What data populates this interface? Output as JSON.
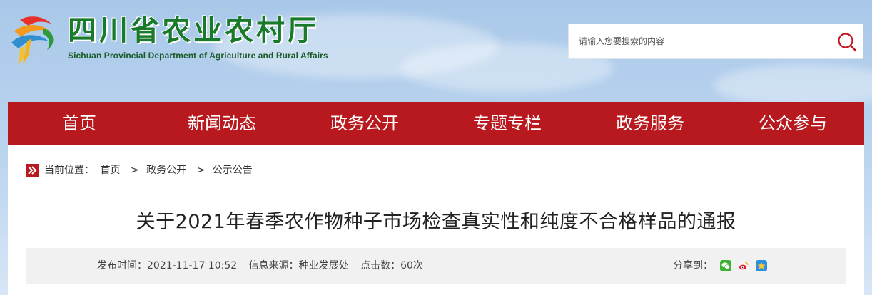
{
  "header": {
    "logo_cn": "四川省农业农村厅",
    "logo_en": "Sichuan Provincial Department of Agriculture and Rural Affairs",
    "search": {
      "placeholder": "请输入您要搜索的内容",
      "value": ""
    }
  },
  "nav": {
    "items": [
      {
        "label": "首页"
      },
      {
        "label": "新闻动态"
      },
      {
        "label": "政务公开"
      },
      {
        "label": "专题专栏"
      },
      {
        "label": "政务服务"
      },
      {
        "label": "公众参与"
      }
    ]
  },
  "breadcrumb": {
    "prefix": "当前位置：",
    "items": [
      "首页",
      "政务公开",
      "公示公告"
    ],
    "separator": ">"
  },
  "article": {
    "title": "关于2021年春季农作物种子市场检查真实性和纯度不合格样品的通报",
    "publish_time": "发布时间：2021-11-17 10:52",
    "source": "信息来源：种业发展处",
    "clicks": "点击数：60次",
    "share_label": "分享到：",
    "share_icons": [
      "wechat-icon",
      "weibo-icon",
      "qzone-icon"
    ]
  },
  "colors": {
    "nav_bg": "#b7191f",
    "logo_green": "#1a7a2c",
    "search_icon": "#c4161c"
  }
}
